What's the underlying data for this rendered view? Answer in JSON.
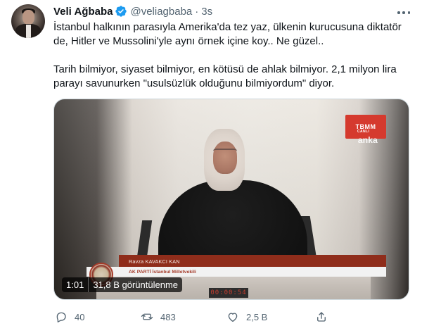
{
  "tweet": {
    "author": {
      "name": "Veli Ağbaba",
      "handle": "@veliagbaba",
      "separator": "·",
      "time": "3s",
      "verified": true
    },
    "text_paragraphs": [
      "İstanbul halkının parasıyla Amerika'da tez yaz, ülkenin kurucusuna diktatör de, Hitler ve Mussolini'yle aynı örnek içine koy.. Ne güzel..",
      "Tarih bilmiyor, siyaset bilmiyor, en kötüsü de ahlak bilmiyor. 2,1 milyon lira parayı savunurken \"usulsüzlük olduğunu bilmiyordum\" diyor."
    ],
    "media": {
      "overlay": {
        "duration": "1:01",
        "views": "31,8 B görüntülenme"
      },
      "video_content": {
        "tbmm_logo": "TBMM",
        "tbmm_subtitle": "CANLI",
        "anka": "anka",
        "speaker_name": "Ravza KAVAKCI KAN",
        "speaker_title": "AK PARTİ İstanbul Milletvekili",
        "timer": "00:00:54"
      }
    },
    "actions": {
      "replies": "40",
      "retweets": "483",
      "likes": "2,5 B"
    }
  },
  "colors": {
    "text_primary": "#0f1419",
    "text_secondary": "#536471",
    "verified_blue": "#1d9bf0",
    "border": "#cfd9de"
  },
  "icons": {
    "verified": "verified-badge-icon",
    "more": "more-icon",
    "reply": "reply-icon",
    "retweet": "retweet-icon",
    "like": "heart-icon",
    "share": "share-icon"
  }
}
